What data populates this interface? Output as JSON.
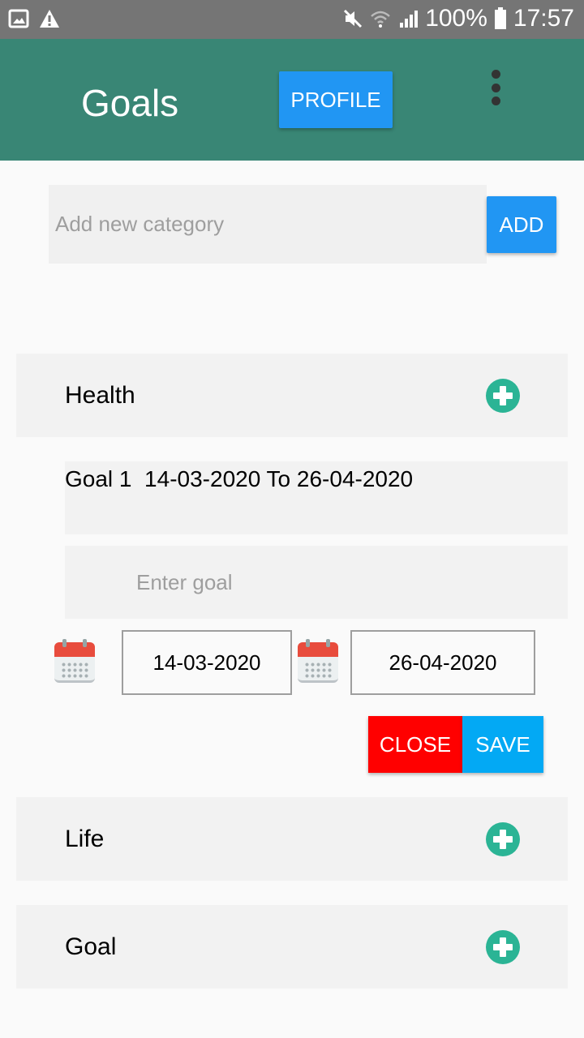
{
  "status_bar": {
    "battery": "100%",
    "time": "17:57",
    "icons": [
      "image-icon",
      "warning-icon",
      "mute-icon",
      "wifi-icon",
      "signal-icon",
      "battery-icon"
    ]
  },
  "appbar": {
    "title": "Goals",
    "profile_label": "PROFILE",
    "menu_icon": "overflow-menu-icon",
    "color": "#398675"
  },
  "new_category": {
    "placeholder": "Add new category",
    "add_label": "ADD"
  },
  "categories": [
    {
      "label": "Health",
      "expanded": true
    },
    {
      "label": "Life",
      "expanded": false
    },
    {
      "label": "Goal",
      "expanded": false
    }
  ],
  "health_goals": {
    "items": [
      {
        "text": "Goal 1  14-03-2020 To 26-04-2020"
      }
    ],
    "goal_placeholder": "Enter goal",
    "start_date": "14-03-2020",
    "end_date": "26-04-2020",
    "close_label": "CLOSE",
    "save_label": "SAVE"
  },
  "colors": {
    "accent": "#2196f3",
    "add_icon": "#2bb495",
    "close": "#ff0000",
    "save": "#03a9f4"
  }
}
